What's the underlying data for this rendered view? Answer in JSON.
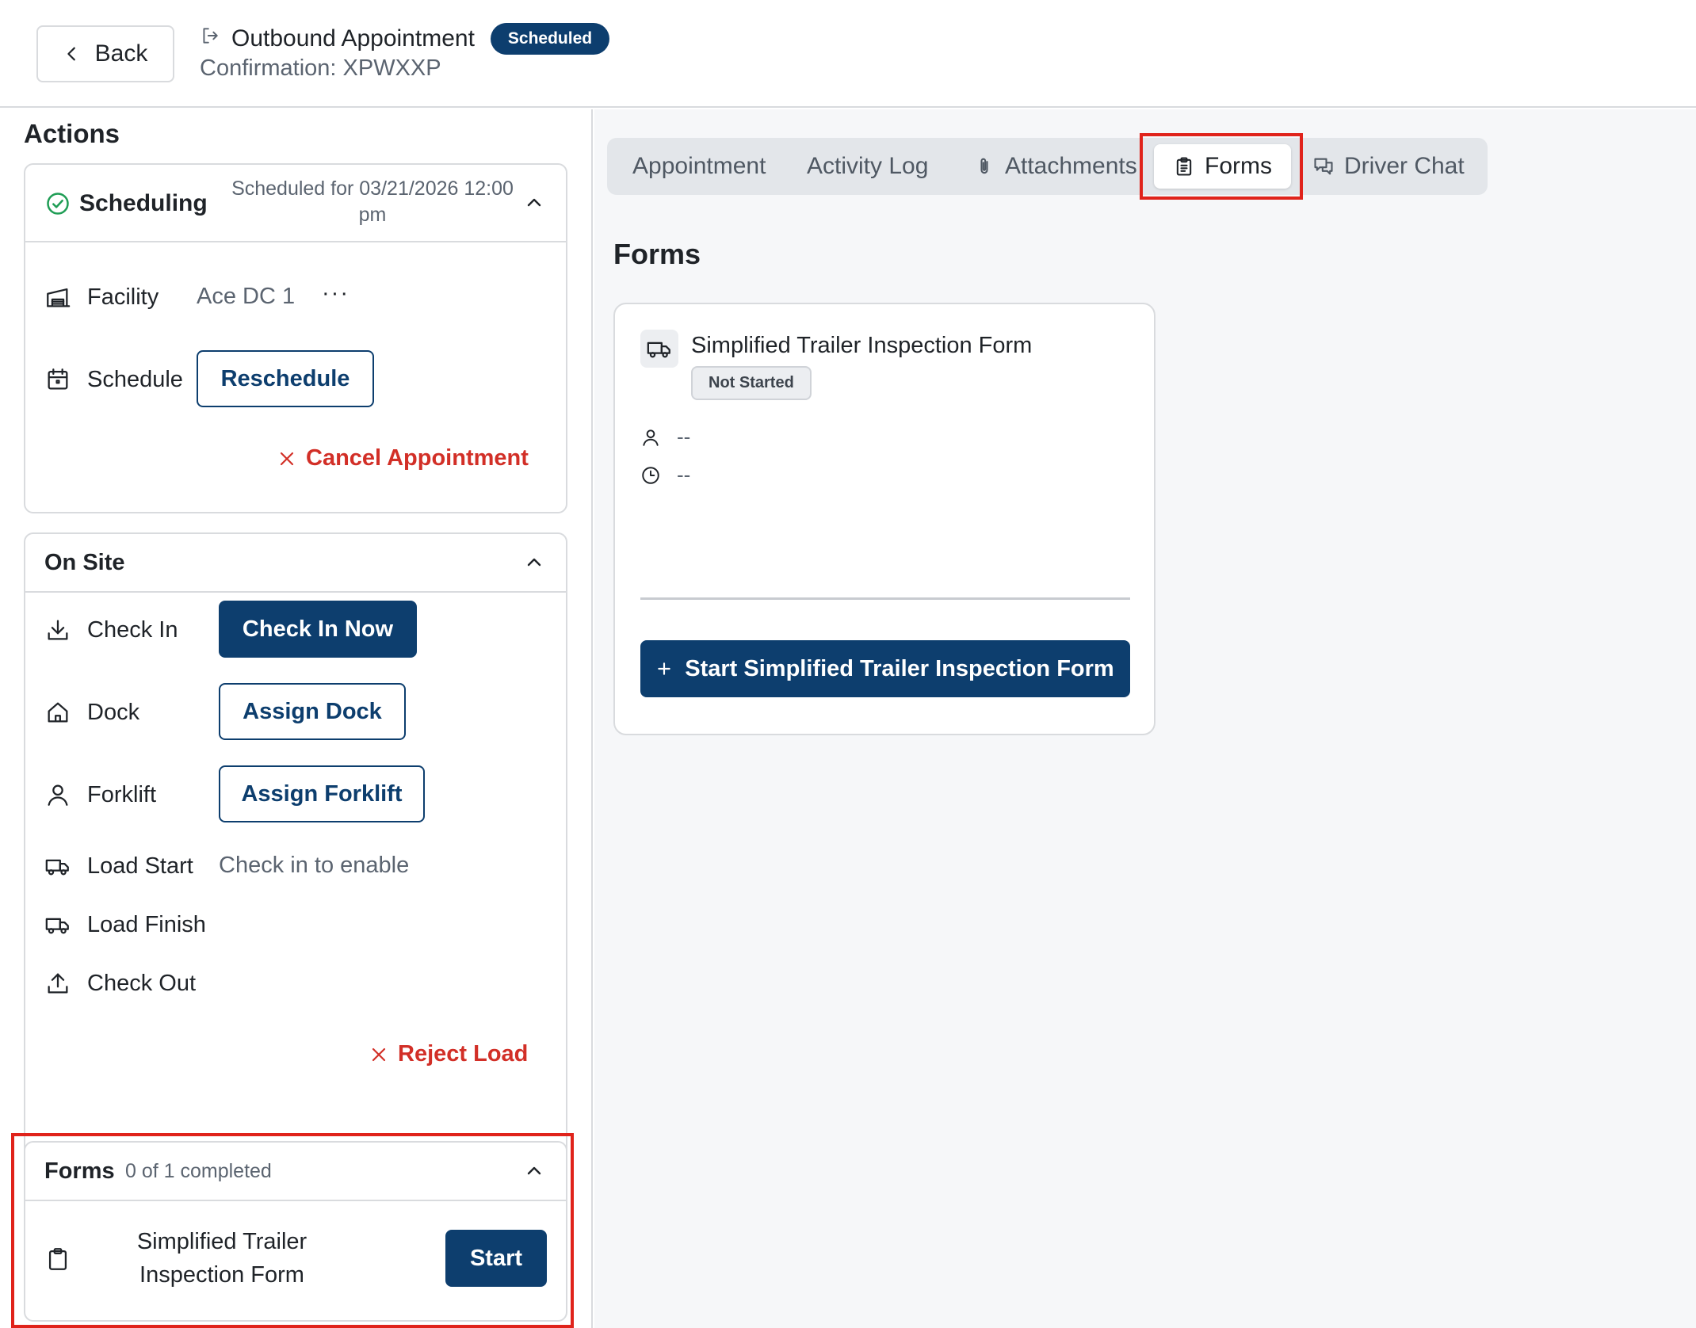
{
  "header": {
    "back_label": "Back",
    "title": "Outbound Appointment",
    "status_badge": "Scheduled",
    "confirmation": "Confirmation: XPWXXP"
  },
  "actions": {
    "title": "Actions",
    "scheduling": {
      "title": "Scheduling",
      "scheduled_for": "Scheduled for 03/21/2026 12:00 pm",
      "facility_label": "Facility",
      "facility_value": "Ace DC 1",
      "more_label": "···",
      "schedule_label": "Schedule",
      "reschedule_label": "Reschedule",
      "cancel_label": "Cancel Appointment"
    },
    "onsite": {
      "title": "On Site",
      "check_in_label": "Check In",
      "check_in_button": "Check In Now",
      "dock_label": "Dock",
      "dock_button": "Assign Dock",
      "forklift_label": "Forklift",
      "forklift_button": "Assign Forklift",
      "load_start_label": "Load Start",
      "load_start_hint": "Check in to enable",
      "load_finish_label": "Load Finish",
      "check_out_label": "Check Out",
      "reject_label": "Reject Load"
    },
    "forms": {
      "title": "Forms",
      "progress": "0 of 1 completed",
      "item_name": "Simplified Trailer Inspection Form",
      "start_label": "Start"
    }
  },
  "tabs": [
    {
      "label": "Appointment"
    },
    {
      "label": "Activity Log"
    },
    {
      "label": "Attachments"
    },
    {
      "label": "Forms"
    },
    {
      "label": "Driver Chat"
    }
  ],
  "forms_panel": {
    "title": "Forms",
    "card": {
      "title": "Simplified Trailer Inspection Form",
      "status": "Not Started",
      "assignee": "--",
      "time": "--",
      "start_button": "Start Simplified Trailer Inspection Form"
    }
  },
  "colors": {
    "primary": "#0d3e6e",
    "danger": "#d22f27",
    "highlight": "#e0231b"
  }
}
